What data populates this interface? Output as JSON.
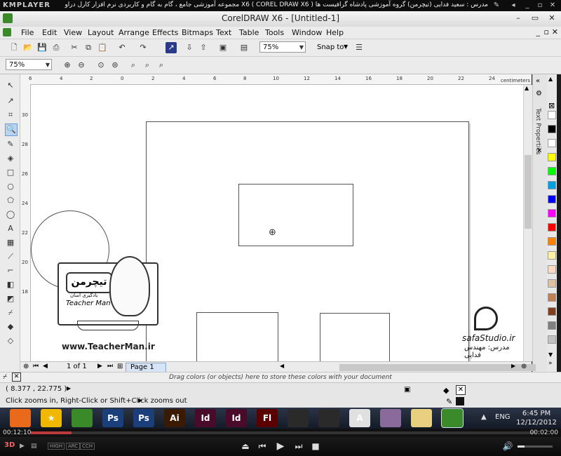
{
  "km": {
    "logo": "KMPLAYER",
    "title": "مجموعه آموزشی جامع ، گام به گام و کاربردی نرم افزار کارل دراو X6 ( COREL DRAW X6 )  مدرس : سعید فدایی (تیچرمن) گروه آموزشی پادشاه گرافیست ها",
    "elapsed": "00:12:10",
    "total": "00:02:00",
    "progress_fraction": 0.08,
    "quality_tags": [
      "HIGH",
      "ARC",
      "CCH"
    ]
  },
  "window": {
    "title": "CorelDRAW X6 - [Untitled-1]",
    "controls": [
      "–",
      "▭",
      "✕"
    ]
  },
  "menu": [
    "File",
    "Edit",
    "View",
    "Layout",
    "Arrange",
    "Effects",
    "Bitmaps",
    "Text",
    "Table",
    "Tools",
    "Window",
    "Help"
  ],
  "toolbar": {
    "zoom_value": "75%",
    "snap_label": "Snap to",
    "zoom_value2": "75%"
  },
  "ruler": {
    "units": "centimeters",
    "h_ticks": [
      "6",
      "4",
      "2",
      "0",
      "2",
      "4",
      "6",
      "8",
      "10",
      "12",
      "14",
      "16",
      "18",
      "20",
      "22",
      "24"
    ],
    "v_ticks": [
      "30",
      "28",
      "26",
      "24",
      "22",
      "20",
      "18"
    ]
  },
  "canvas": {
    "watermark_url": "www.TeacherMan.ir",
    "logo_fa": "تیچرمن",
    "logo_sub": "Teacher Man",
    "logo_tag": "یادگیری آسان",
    "studio": "safaStudio.ir",
    "instructor": "مدرس: مهندس فدایی"
  },
  "docker": {
    "label": "Text Properties"
  },
  "palette": [
    "#ffffff",
    "#000000",
    "#ffffff",
    "#ffff00",
    "#00ff00",
    "#00a0e0",
    "#0000ff",
    "#ff00ff",
    "#ff0000",
    "#ff8000",
    "#fff2a0",
    "#ffd8c0",
    "#e0c0a0",
    "#c08050",
    "#804020",
    "#808080",
    "#c0c0c0"
  ],
  "pagenav": {
    "page_count": "1 of 1",
    "page_tab": "Page 1"
  },
  "dragbar": {
    "text": "Drag colors (or objects) here to store these colors with your document"
  },
  "status": {
    "coords": "( 8.377 , 22.775 )",
    "hint": "Click zooms in, Right-Click or Shift+Click zooms out"
  },
  "taskbar": {
    "apps": [
      {
        "name": "firefox",
        "label": "",
        "color": "#e86a1a"
      },
      {
        "name": "star",
        "label": "★",
        "color": "#f0b800"
      },
      {
        "name": "coreldraw",
        "label": "",
        "color": "#3a8a2a"
      },
      {
        "name": "photoshop-1",
        "label": "Ps",
        "color": "#1a3f7a"
      },
      {
        "name": "photoshop-2",
        "label": "Ps",
        "color": "#1a3f7a"
      },
      {
        "name": "illustrator",
        "label": "Ai",
        "color": "#3a1a00"
      },
      {
        "name": "indesign-1",
        "label": "Id",
        "color": "#4a0a2a"
      },
      {
        "name": "indesign-2",
        "label": "Id",
        "color": "#4a0a2a"
      },
      {
        "name": "flash",
        "label": "Fl",
        "color": "#5a0000"
      },
      {
        "name": "app-gear-1",
        "label": "",
        "color": "#2a2a2a"
      },
      {
        "name": "app-gear-2",
        "label": "",
        "color": "#2a2a2a"
      },
      {
        "name": "acrobat",
        "label": "A",
        "color": "#e0e0e0"
      },
      {
        "name": "dvd",
        "label": "",
        "color": "#8a6a9a"
      },
      {
        "name": "folder",
        "label": "",
        "color": "#e8d080"
      },
      {
        "name": "coreldraw-active",
        "label": "",
        "color": "#3a8a2a"
      }
    ],
    "lang": "ENG",
    "time": "6:45 PM",
    "date": "12/12/2012"
  }
}
